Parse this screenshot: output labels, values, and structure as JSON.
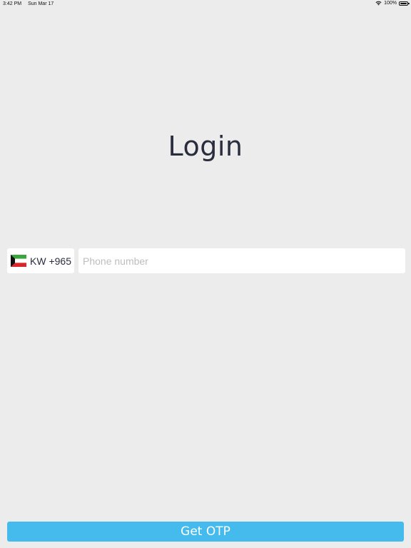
{
  "status_bar": {
    "time": "3:42 PM",
    "date": "Sun Mar 17",
    "battery": "100%",
    "wifi_icon": "wifi-icon",
    "battery_icon": "battery-icon"
  },
  "login": {
    "title": "Login",
    "country": {
      "flag_icon": "kuwait-flag-icon",
      "label": "KW +965"
    },
    "phone": {
      "value": "",
      "placeholder": "Phone number"
    },
    "submit_label": "Get OTP"
  },
  "colors": {
    "background": "#ececec",
    "text": "#2a2d3e",
    "button": "#44bbec",
    "button_text": "#ffffff",
    "placeholder": "#bdbdc2"
  }
}
